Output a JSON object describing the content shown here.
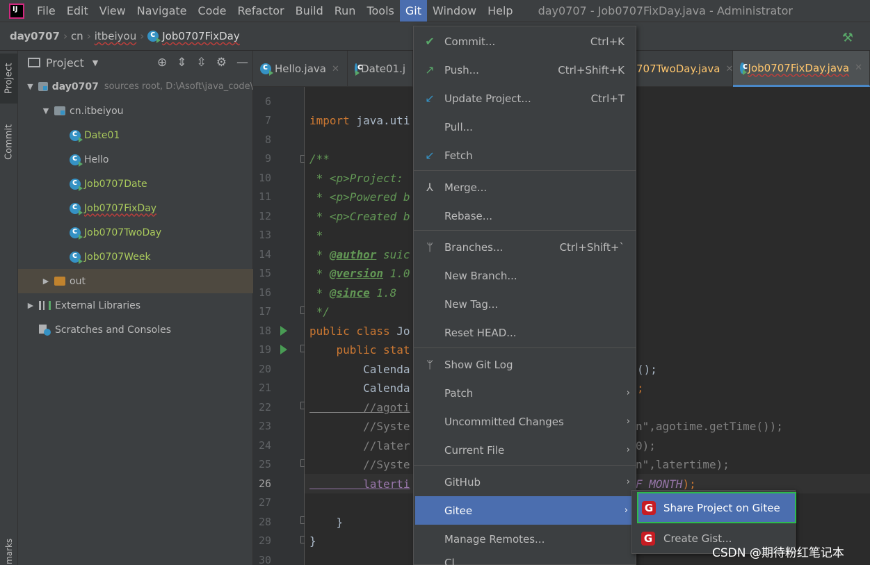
{
  "menubar": {
    "items": [
      "File",
      "Edit",
      "View",
      "Navigate",
      "Code",
      "Refactor",
      "Build",
      "Run",
      "Tools",
      "Git",
      "Window",
      "Help"
    ],
    "active": "Git",
    "window_title": "day0707 - Job0707FixDay.java - Administrator"
  },
  "breadcrumb": {
    "project": "day0707",
    "pkg1": "cn",
    "pkg2": "itbeiyou",
    "file": "Job0707FixDay"
  },
  "toolstrip": {
    "project_label": "Project",
    "commit_label": "Commit",
    "bookmarks_label": "marks"
  },
  "project_panel": {
    "title": "Project",
    "root_name": "day0707",
    "root_hint": "sources root,  D:\\Asoft\\java_code\\",
    "package": "cn.itbeiyou",
    "files": [
      "Date01",
      "Hello",
      "Job0707Date",
      "Job0707FixDay",
      "Job0707TwoDay",
      "Job0707Week"
    ],
    "out": "out",
    "external": "External Libraries",
    "scratches": "Scratches and Consoles"
  },
  "tabs": {
    "hello": "Hello.java",
    "date": "Date01.j",
    "twoday": "707TwoDay.java",
    "fixday": "Job0707FixDay.java"
  },
  "editor": {
    "line_numbers": [
      "6",
      "7",
      "8",
      "9",
      "10",
      "11",
      "12",
      "13",
      "14",
      "15",
      "16",
      "17",
      "18",
      "19",
      "20",
      "21",
      "22",
      "23",
      "24",
      "25",
      "26",
      "27",
      "28",
      "29",
      "30"
    ],
    "current_line": "26",
    "code": {
      "l7_kw": "import",
      "l7_rest": " java.uti",
      "l9": "/**",
      "l10": " * <p>Project:",
      "l11": " * <p>Powered b",
      "l12": " * <p>Created b",
      "l13": " *",
      "l14_pre": " * ",
      "l14_tag": "@author",
      "l14_post": " suic",
      "l15_pre": " * ",
      "l15_tag": "@version",
      "l15_post": " 1.0",
      "l16_pre": " * ",
      "l16_tag": "@since",
      "l16_post": " 1.8",
      "l17": " */",
      "l18_kw": "public class",
      "l18_rest": " Jo",
      "l19_kw": "    public stat",
      "l20": "        Calenda",
      "l20_tail": "();",
      "l21": "        Calenda",
      "l21_tail": ";",
      "l22": "        //agoti",
      "l23": "        //Syste",
      "l23_tail": "n\",agotime.getTime());",
      "l24": "        //later",
      "l24_tail": "0);",
      "l25": "        //Syste",
      "l25_tail": "n\",latertime);",
      "l26": "        laterti",
      "l26_tail_mag": "F_MONTH",
      "l26_tail_end": ");",
      "l28": "    }",
      "l29": "}"
    }
  },
  "git_menu": {
    "commit": "Commit...",
    "commit_sc": "Ctrl+K",
    "push": "Push...",
    "push_sc": "Ctrl+Shift+K",
    "update": "Update Project...",
    "update_sc": "Ctrl+T",
    "pull": "Pull...",
    "fetch": "Fetch",
    "merge": "Merge...",
    "rebase": "Rebase...",
    "branches": "Branches...",
    "branches_sc": "Ctrl+Shift+`",
    "new_branch": "New Branch...",
    "new_tag": "New Tag...",
    "reset_head": "Reset HEAD...",
    "show_log": "Show Git Log",
    "patch": "Patch",
    "uncommitted": "Uncommitted Changes",
    "current_file": "Current File",
    "github": "GitHub",
    "gitee": "Gitee",
    "manage_remotes": "Manage Remotes...",
    "clone": "Cl..."
  },
  "gitee_submenu": {
    "share": "Share Project on Gitee",
    "gist": "Create Gist..."
  },
  "watermark": "CSDN @期待粉红笔记本",
  "colors": {
    "accent": "#4b6eaf",
    "highlight_outline": "#2dbb4d",
    "gitee_red": "#c71d23",
    "keyword": "#cc7832",
    "doc_comment": "#629755"
  }
}
